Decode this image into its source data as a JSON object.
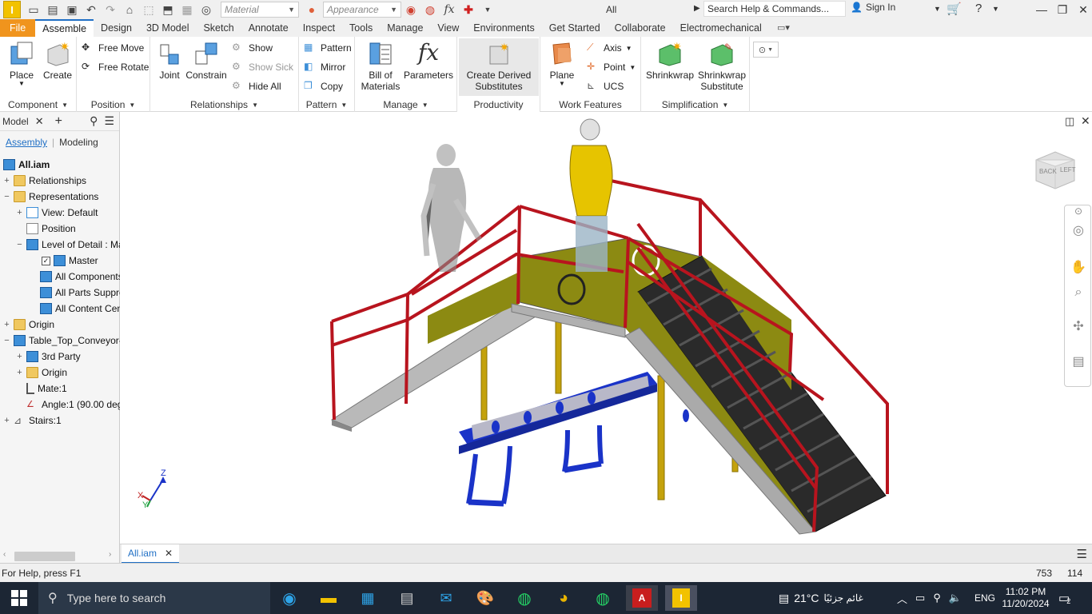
{
  "quickaccess": {
    "material_placeholder": "Material",
    "appearance_placeholder": "Appearance",
    "filter_value": "All",
    "search_placeholder": "Search Help & Commands...",
    "sign_in": "Sign In"
  },
  "menu": [
    "File",
    "Assemble",
    "Design",
    "3D Model",
    "Sketch",
    "Annotate",
    "Inspect",
    "Tools",
    "Manage",
    "View",
    "Environments",
    "Get Started",
    "Collaborate",
    "Electromechanical"
  ],
  "active_menu": "Assemble",
  "ribbon": {
    "component": {
      "title": "Component",
      "place": "Place",
      "create": "Create"
    },
    "position": {
      "title": "Position",
      "free_move": "Free Move",
      "free_rotate": "Free Rotate"
    },
    "relationships": {
      "title": "Relationships",
      "joint": "Joint",
      "constrain": "Constrain",
      "show": "Show",
      "show_sick": "Show Sick",
      "hide_all": "Hide All"
    },
    "pattern": {
      "title": "Pattern",
      "pattern": "Pattern",
      "mirror": "Mirror",
      "copy": "Copy"
    },
    "manage": {
      "title": "Manage",
      "bom_line1": "Bill of",
      "bom_line2": "Materials",
      "parameters": "Parameters"
    },
    "productivity": {
      "title": "Productivity",
      "derived_line1": "Create Derived",
      "derived_line2": "Substitutes"
    },
    "work_features": {
      "title": "Work Features",
      "plane": "Plane",
      "axis": "Axis",
      "point": "Point",
      "ucs": "UCS"
    },
    "simplification": {
      "title": "Simplification",
      "shrinkwrap": "Shrinkwrap",
      "sw_sub_line1": "Shrinkwrap",
      "sw_sub_line2": "Substitute"
    }
  },
  "model_panel": {
    "title": "Model",
    "tab_assembly": "Assembly",
    "tab_modeling": "Modeling",
    "tree": {
      "root": "All.iam",
      "relationships": "Relationships",
      "representations": "Representations",
      "view": "View: Default",
      "position": "Position",
      "lod": "Level of Detail : Ma:",
      "master": "Master",
      "all_components": "All Components",
      "all_parts": "All Parts Suppre:",
      "all_content": "All Content Cent",
      "origin": "Origin",
      "table_top": "Table_Top_Conveyor-S",
      "third_party": "3rd Party",
      "origin2": "Origin",
      "mate": "Mate:1",
      "angle": "Angle:1 (90.00 deg",
      "stairs": "Stairs:1"
    }
  },
  "viewcube": {
    "back": "BACK",
    "left": "LEFT"
  },
  "axes": {
    "x": "X",
    "y": "Y",
    "z": "Z"
  },
  "document_tab": "All.iam",
  "status": {
    "help": "For Help, press F1",
    "count1": "753",
    "count2": "114"
  },
  "taskbar": {
    "search_placeholder": "Type here to search",
    "weather": "21°C",
    "weather_desc": "غائم جزئيًا",
    "lang": "ENG",
    "time": "11:02 PM",
    "date": "11/20/2024",
    "notifications": "2"
  },
  "colors": {
    "accent": "#1f6fc5",
    "file_tab": "#f0941d",
    "railing": "#b8141e",
    "panel": "#8c8a12",
    "conveyor": "#1a33c8",
    "taskbar": "#1c2634"
  }
}
